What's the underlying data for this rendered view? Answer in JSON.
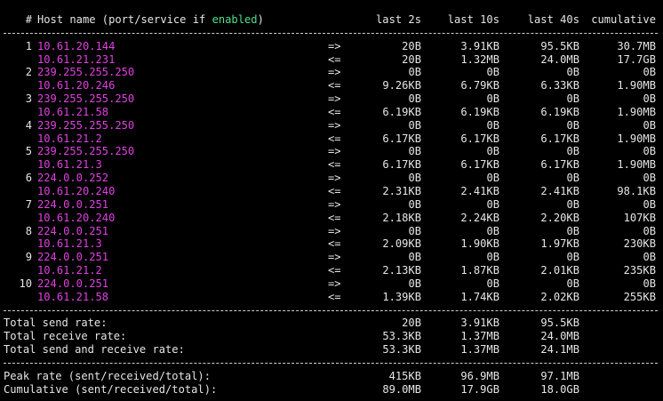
{
  "header": {
    "index_col": "#",
    "name_prefix": "Host name (port/service if ",
    "name_enabled": "enabled",
    "name_suffix": ")",
    "col1": "last 2s",
    "col2": "last 10s",
    "col3": "last 40s",
    "col4": "cumulative"
  },
  "colors": {
    "host": "#e040e0",
    "enabled": "#4ee08a",
    "text": "#e5e5e5",
    "background": "#000000"
  },
  "connections": [
    {
      "index": "1",
      "local": "10.61.20.144",
      "send": [
        "20B",
        "3.91KB",
        "95.5KB",
        "30.7MB"
      ],
      "remote": "10.61.21.231",
      "recv": [
        "20B",
        "1.32MB",
        "24.0MB",
        "17.7GB"
      ]
    },
    {
      "index": "2",
      "local": "239.255.255.250",
      "send": [
        "0B",
        "0B",
        "0B",
        "0B"
      ],
      "remote": "10.61.20.246",
      "recv": [
        "9.26KB",
        "6.79KB",
        "6.33KB",
        "1.90MB"
      ]
    },
    {
      "index": "3",
      "local": "239.255.255.250",
      "send": [
        "0B",
        "0B",
        "0B",
        "0B"
      ],
      "remote": "10.61.21.58",
      "recv": [
        "6.19KB",
        "6.19KB",
        "6.19KB",
        "1.90MB"
      ]
    },
    {
      "index": "4",
      "local": "239.255.255.250",
      "send": [
        "0B",
        "0B",
        "0B",
        "0B"
      ],
      "remote": "10.61.21.2",
      "recv": [
        "6.17KB",
        "6.17KB",
        "6.17KB",
        "1.90MB"
      ]
    },
    {
      "index": "5",
      "local": "239.255.255.250",
      "send": [
        "0B",
        "0B",
        "0B",
        "0B"
      ],
      "remote": "10.61.21.3",
      "recv": [
        "6.17KB",
        "6.17KB",
        "6.17KB",
        "1.90MB"
      ]
    },
    {
      "index": "6",
      "local": "224.0.0.252",
      "send": [
        "0B",
        "0B",
        "0B",
        "0B"
      ],
      "remote": "10.61.20.240",
      "recv": [
        "2.31KB",
        "2.41KB",
        "2.41KB",
        "98.1KB"
      ]
    },
    {
      "index": "7",
      "local": "224.0.0.251",
      "send": [
        "0B",
        "0B",
        "0B",
        "0B"
      ],
      "remote": "10.61.20.240",
      "recv": [
        "2.18KB",
        "2.24KB",
        "2.20KB",
        "107KB"
      ]
    },
    {
      "index": "8",
      "local": "224.0.0.251",
      "send": [
        "0B",
        "0B",
        "0B",
        "0B"
      ],
      "remote": "10.61.21.3",
      "recv": [
        "2.09KB",
        "1.90KB",
        "1.97KB",
        "230KB"
      ]
    },
    {
      "index": "9",
      "local": "224.0.0.251",
      "send": [
        "0B",
        "0B",
        "0B",
        "0B"
      ],
      "remote": "10.61.21.2",
      "recv": [
        "2.13KB",
        "1.87KB",
        "2.01KB",
        "235KB"
      ]
    },
    {
      "index": "10",
      "local": "224.0.0.251",
      "send": [
        "0B",
        "0B",
        "0B",
        "0B"
      ],
      "remote": "10.61.21.58",
      "recv": [
        "1.39KB",
        "1.74KB",
        "2.02KB",
        "255KB"
      ]
    }
  ],
  "directions": {
    "send": "=>",
    "recv": "<="
  },
  "totals": [
    {
      "label": "Total send rate:",
      "values": [
        "20B",
        "3.91KB",
        "95.5KB"
      ]
    },
    {
      "label": "Total receive rate:",
      "values": [
        "53.3KB",
        "1.37MB",
        "24.0MB"
      ]
    },
    {
      "label": "Total send and receive rate:",
      "values": [
        "53.3KB",
        "1.37MB",
        "24.1MB"
      ]
    }
  ],
  "summary": [
    {
      "label": "Peak rate (sent/received/total):",
      "values": [
        "415KB",
        "96.9MB",
        "97.1MB"
      ]
    },
    {
      "label": "Cumulative (sent/received/total):",
      "values": [
        "89.0MB",
        "17.9GB",
        "18.0GB"
      ]
    }
  ]
}
